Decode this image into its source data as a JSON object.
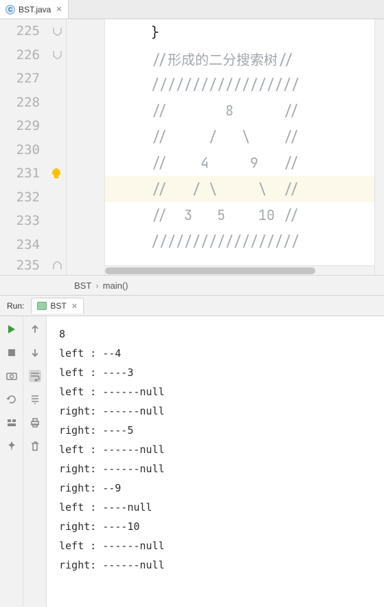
{
  "tab": {
    "label": "BST.java",
    "icon_letter": "C"
  },
  "editor": {
    "lines": [
      {
        "num": "225",
        "text": "}",
        "brace": true,
        "fold": "end"
      },
      {
        "num": "226",
        "text": "//形成的二分搜索树//",
        "fold": "end"
      },
      {
        "num": "227",
        "text": "//////////////////"
      },
      {
        "num": "228",
        "text": "//       8      //"
      },
      {
        "num": "229",
        "text": "//     /   \\    //"
      },
      {
        "num": "230",
        "text": "//    4     9   //"
      },
      {
        "num": "231",
        "text": "//   / \\     \\  //",
        "hl": true,
        "bulb": true
      },
      {
        "num": "232",
        "text": "//  3   5    10 //"
      },
      {
        "num": "233",
        "text": "//////////////////"
      },
      {
        "num": "234",
        "text": ""
      },
      {
        "num": "235",
        "text": "",
        "fold": "start"
      }
    ]
  },
  "breadcrumb": {
    "class": "BST",
    "method": "main()"
  },
  "run": {
    "label": "Run:",
    "tab": "BST",
    "output": [
      "8",
      "left : --4",
      "left : ----3",
      "left : ------null",
      "right: ------null",
      "right: ----5",
      "left : ------null",
      "right: ------null",
      "right: --9",
      "left : ----null",
      "right: ----10",
      "left : ------null",
      "right: ------null"
    ]
  },
  "icons": {
    "play": "play-icon",
    "stop": "stop-icon",
    "camera": "camera-icon",
    "rerun": "rerun-icon",
    "layout": "layout-icon",
    "pin": "pin-icon",
    "up": "up-arrow-icon",
    "down": "down-arrow-icon",
    "wrap": "wrap-icon",
    "scroll": "scroll-icon",
    "print": "print-icon",
    "trash": "trash-icon"
  }
}
